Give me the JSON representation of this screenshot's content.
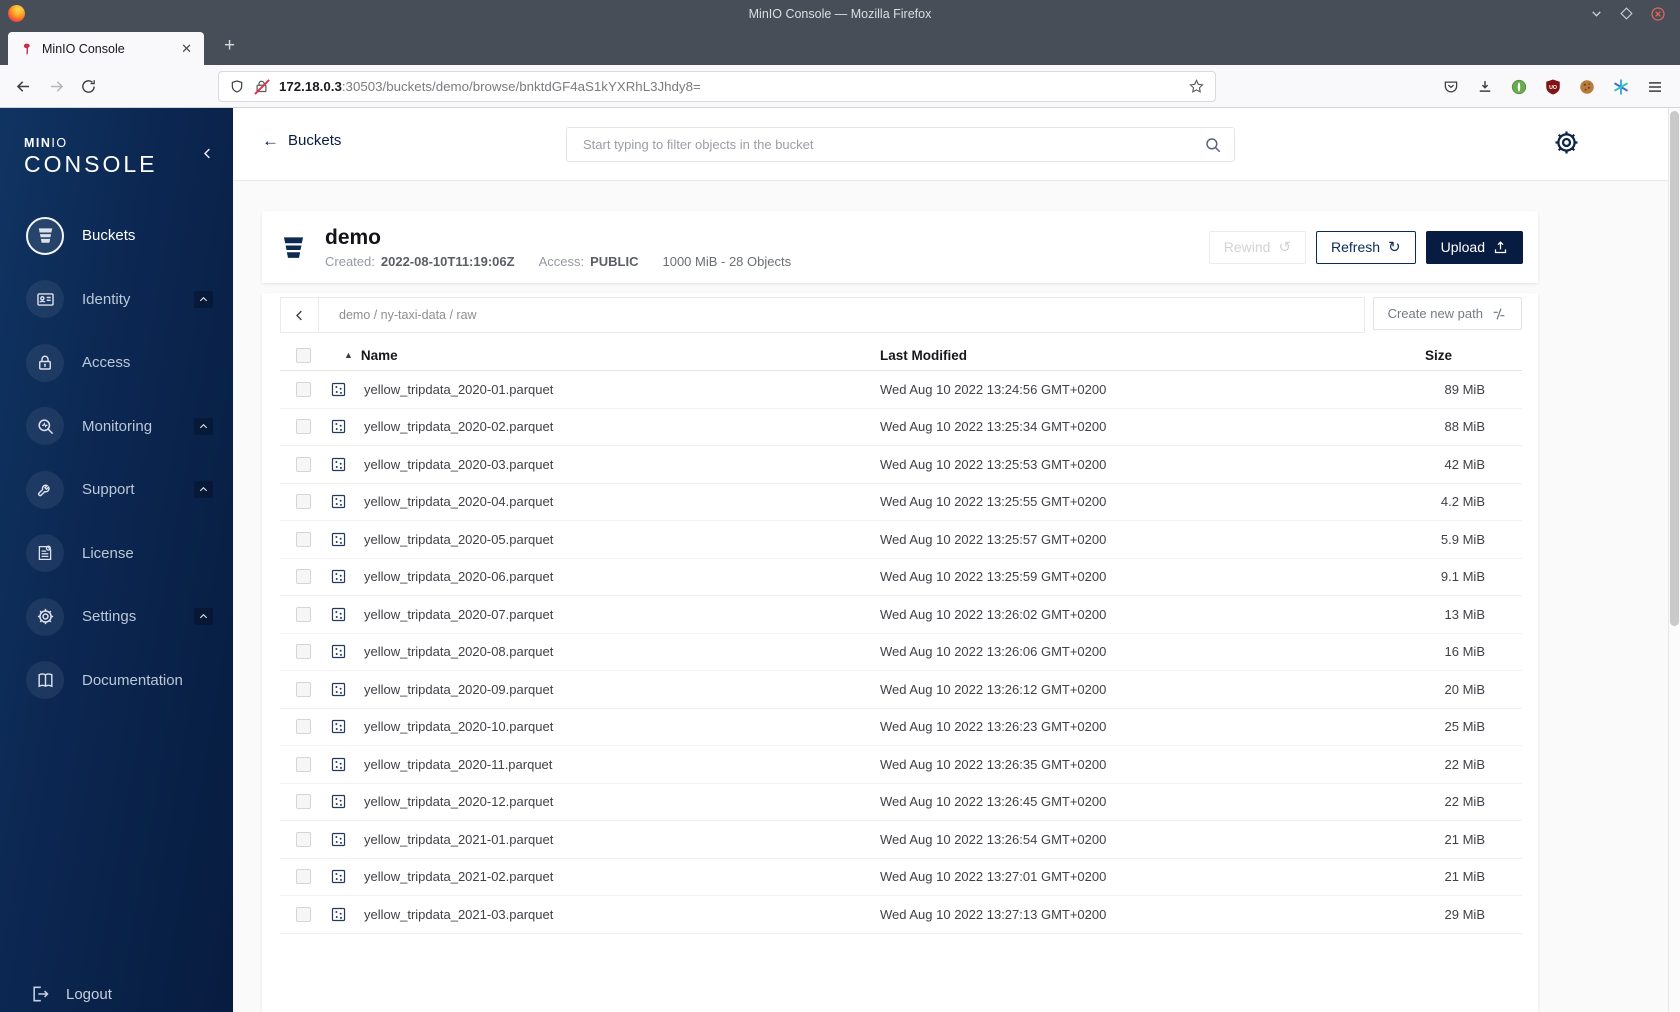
{
  "browser": {
    "window_title": "MinIO Console — Mozilla Firefox",
    "tab_title": "MinIO Console",
    "url_host": "172.18.0.3",
    "url_rest": ":30503/buckets/demo/browse/bnktdGF4aS1kYXRhL3Jhdy8="
  },
  "icons": {
    "close": "✕",
    "plus": "+",
    "back_arrow": "←",
    "forward_arrow": "→",
    "sort_asc": "▲",
    "rewind_glyph": "↺",
    "refresh_glyph": "↻",
    "collapse_chevron": "‹",
    "path_back_chevron": "‹"
  },
  "sidebar": {
    "logo_min": "MIN",
    "logo_io": "IO",
    "logo_console": "CONSOLE",
    "items": [
      {
        "label": "Buckets",
        "icon": "bucket",
        "active": true,
        "expandable": false
      },
      {
        "label": "Identity",
        "icon": "identity",
        "active": false,
        "expandable": true
      },
      {
        "label": "Access",
        "icon": "access",
        "active": false,
        "expandable": false
      },
      {
        "label": "Monitoring",
        "icon": "monitoring",
        "active": false,
        "expandable": true
      },
      {
        "label": "Support",
        "icon": "support",
        "active": false,
        "expandable": true
      },
      {
        "label": "License",
        "icon": "license",
        "active": false,
        "expandable": false
      },
      {
        "label": "Settings",
        "icon": "settings",
        "active": false,
        "expandable": true
      },
      {
        "label": "Documentation",
        "icon": "documentation",
        "active": false,
        "expandable": false
      }
    ],
    "logout_label": "Logout"
  },
  "header": {
    "back_label": "Buckets",
    "search_placeholder": "Start typing to filter objects in the bucket"
  },
  "bucket": {
    "name": "demo",
    "created_label": "Created:",
    "created_value": "2022-08-10T11:19:06Z",
    "access_label": "Access:",
    "access_value": "PUBLIC",
    "summary": "1000 MiB - 28 Objects",
    "rewind_label": "Rewind",
    "refresh_label": "Refresh",
    "upload_label": "Upload"
  },
  "browse": {
    "path": "demo / ny-taxi-data / raw",
    "create_path_label": "Create new path"
  },
  "table": {
    "columns": [
      "Name",
      "Last Modified",
      "Size"
    ],
    "rows": [
      {
        "name": "yellow_tripdata_2020-01.parquet",
        "modified": "Wed Aug 10 2022 13:24:56 GMT+0200",
        "size": "89 MiB"
      },
      {
        "name": "yellow_tripdata_2020-02.parquet",
        "modified": "Wed Aug 10 2022 13:25:34 GMT+0200",
        "size": "88 MiB"
      },
      {
        "name": "yellow_tripdata_2020-03.parquet",
        "modified": "Wed Aug 10 2022 13:25:53 GMT+0200",
        "size": "42 MiB"
      },
      {
        "name": "yellow_tripdata_2020-04.parquet",
        "modified": "Wed Aug 10 2022 13:25:55 GMT+0200",
        "size": "4.2 MiB"
      },
      {
        "name": "yellow_tripdata_2020-05.parquet",
        "modified": "Wed Aug 10 2022 13:25:57 GMT+0200",
        "size": "5.9 MiB"
      },
      {
        "name": "yellow_tripdata_2020-06.parquet",
        "modified": "Wed Aug 10 2022 13:25:59 GMT+0200",
        "size": "9.1 MiB"
      },
      {
        "name": "yellow_tripdata_2020-07.parquet",
        "modified": "Wed Aug 10 2022 13:26:02 GMT+0200",
        "size": "13 MiB"
      },
      {
        "name": "yellow_tripdata_2020-08.parquet",
        "modified": "Wed Aug 10 2022 13:26:06 GMT+0200",
        "size": "16 MiB"
      },
      {
        "name": "yellow_tripdata_2020-09.parquet",
        "modified": "Wed Aug 10 2022 13:26:12 GMT+0200",
        "size": "20 MiB"
      },
      {
        "name": "yellow_tripdata_2020-10.parquet",
        "modified": "Wed Aug 10 2022 13:26:23 GMT+0200",
        "size": "25 MiB"
      },
      {
        "name": "yellow_tripdata_2020-11.parquet",
        "modified": "Wed Aug 10 2022 13:26:35 GMT+0200",
        "size": "22 MiB"
      },
      {
        "name": "yellow_tripdata_2020-12.parquet",
        "modified": "Wed Aug 10 2022 13:26:45 GMT+0200",
        "size": "22 MiB"
      },
      {
        "name": "yellow_tripdata_2021-01.parquet",
        "modified": "Wed Aug 10 2022 13:26:54 GMT+0200",
        "size": "21 MiB"
      },
      {
        "name": "yellow_tripdata_2021-02.parquet",
        "modified": "Wed Aug 10 2022 13:27:01 GMT+0200",
        "size": "21 MiB"
      },
      {
        "name": "yellow_tripdata_2021-03.parquet",
        "modified": "Wed Aug 10 2022 13:27:13 GMT+0200",
        "size": "29 MiB"
      }
    ]
  },
  "colors": {
    "navy": "#081C42",
    "sidebar_top": "#103462",
    "sidebar_bottom": "#071c3f",
    "brand_red": "#c72c48",
    "chrome_dark": "#474e57"
  }
}
